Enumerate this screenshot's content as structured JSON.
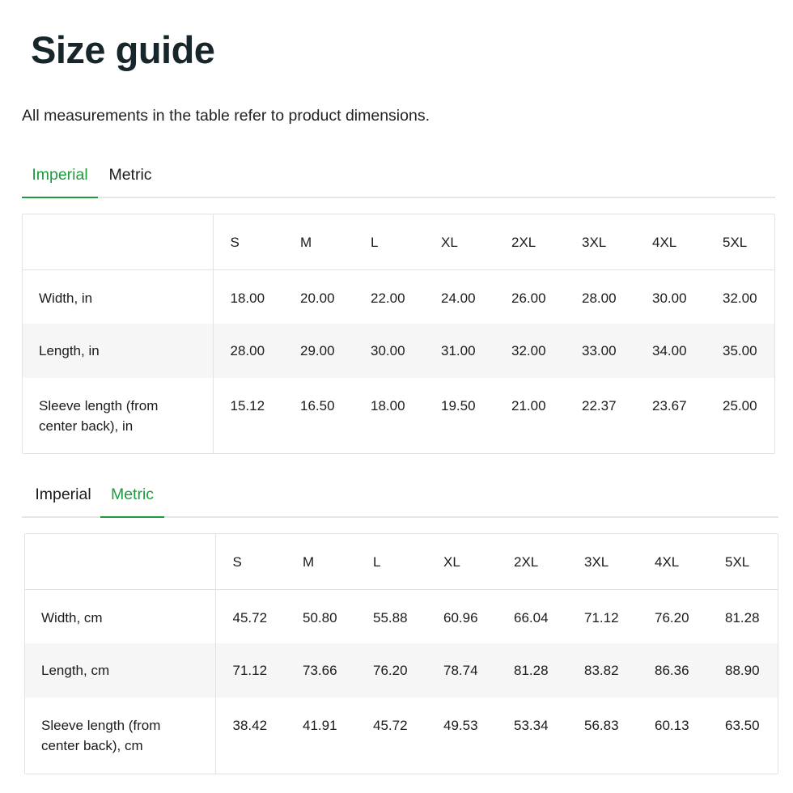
{
  "page": {
    "title": "Size guide",
    "subtitle": "All measurements in the table refer to product dimensions."
  },
  "colors": {
    "accent": "#1f9a3e",
    "stripe": "#f6f6f6",
    "border": "#e3e3e3"
  },
  "sizes": [
    "S",
    "M",
    "L",
    "XL",
    "2XL",
    "3XL",
    "4XL",
    "5XL"
  ],
  "imperial_section": {
    "tabs": [
      {
        "label": "Imperial",
        "active": true
      },
      {
        "label": "Metric",
        "active": false
      }
    ],
    "rows": [
      {
        "label": "Width, in",
        "values": [
          "18.00",
          "20.00",
          "22.00",
          "24.00",
          "26.00",
          "28.00",
          "30.00",
          "32.00"
        ]
      },
      {
        "label": "Length, in",
        "values": [
          "28.00",
          "29.00",
          "30.00",
          "31.00",
          "32.00",
          "33.00",
          "34.00",
          "35.00"
        ]
      },
      {
        "label": "Sleeve length (from center back), in",
        "values": [
          "15.12",
          "16.50",
          "18.00",
          "19.50",
          "21.00",
          "22.37",
          "23.67",
          "25.00"
        ]
      }
    ]
  },
  "metric_section": {
    "tabs": [
      {
        "label": "Imperial",
        "active": false
      },
      {
        "label": "Metric",
        "active": true
      }
    ],
    "rows": [
      {
        "label": "Width, cm",
        "values": [
          "45.72",
          "50.80",
          "55.88",
          "60.96",
          "66.04",
          "71.12",
          "76.20",
          "81.28"
        ]
      },
      {
        "label": "Length, cm",
        "values": [
          "71.12",
          "73.66",
          "76.20",
          "78.74",
          "81.28",
          "83.82",
          "86.36",
          "88.90"
        ]
      },
      {
        "label": "Sleeve length (from center back), cm",
        "values": [
          "38.42",
          "41.91",
          "45.72",
          "49.53",
          "53.34",
          "56.83",
          "60.13",
          "63.50"
        ]
      }
    ]
  }
}
